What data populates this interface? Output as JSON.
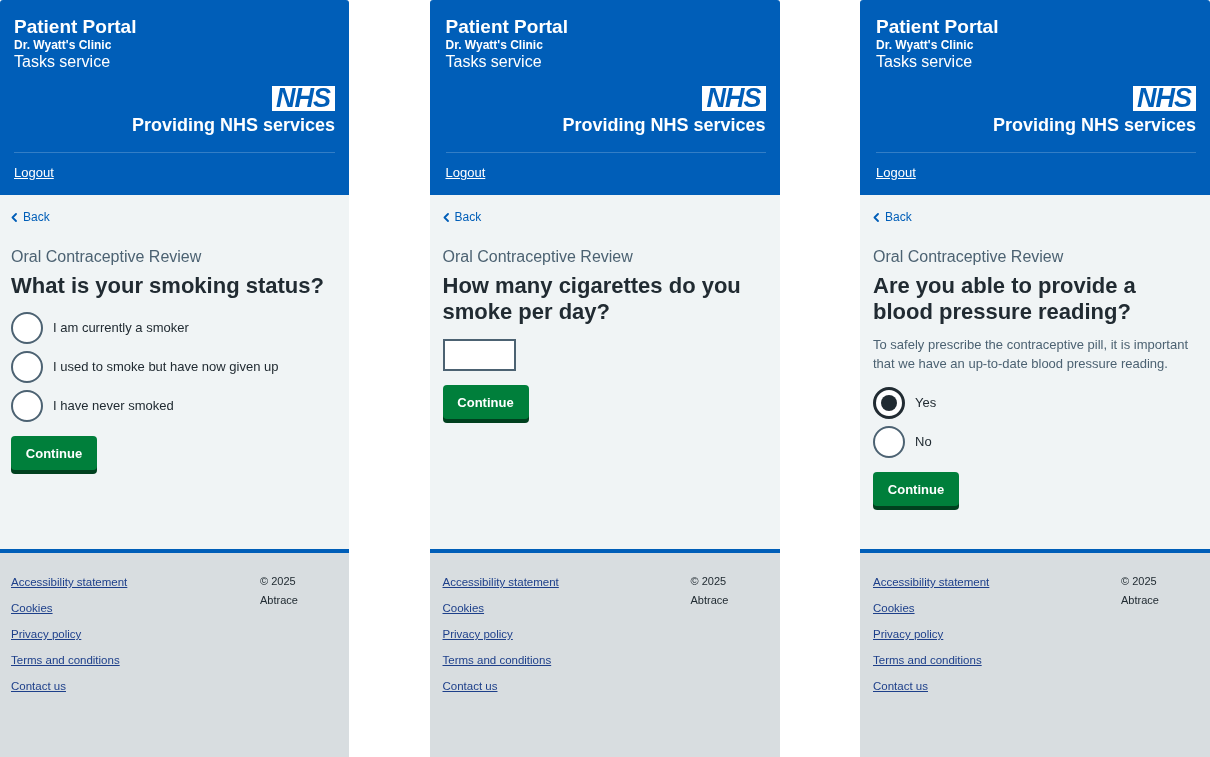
{
  "screens": [
    {
      "header": {
        "title": "Patient Portal",
        "clinic": "Dr. Wyatt's Clinic",
        "service": "Tasks service",
        "logo": "NHS",
        "tagline": "Providing NHS services",
        "logout": "Logout"
      },
      "back": "Back",
      "caption": "Oral Contraceptive Review",
      "question": "What is your smoking status?",
      "kind": "radios",
      "options": [
        {
          "label": "I am currently a smoker",
          "selected": false
        },
        {
          "label": "I used to smoke but have now given up",
          "selected": false
        },
        {
          "label": "I have never smoked",
          "selected": false
        }
      ],
      "button": "Continue",
      "footer": {
        "links": [
          "Accessibility statement",
          "Cookies",
          "Privacy policy",
          "Terms and conditions",
          "Contact us"
        ],
        "copyright": "© 2025",
        "company": "Abtrace"
      }
    },
    {
      "header": {
        "title": "Patient Portal",
        "clinic": "Dr. Wyatt's Clinic",
        "service": "Tasks service",
        "logo": "NHS",
        "tagline": "Providing NHS services",
        "logout": "Logout"
      },
      "back": "Back",
      "caption": "Oral Contraceptive Review",
      "question": "How many cigarettes do you smoke per day?",
      "kind": "text-input",
      "button": "Continue",
      "footer": {
        "links": [
          "Accessibility statement",
          "Cookies",
          "Privacy policy",
          "Terms and conditions",
          "Contact us"
        ],
        "copyright": "© 2025",
        "company": "Abtrace"
      }
    },
    {
      "header": {
        "title": "Patient Portal",
        "clinic": "Dr. Wyatt's Clinic",
        "service": "Tasks service",
        "logo": "NHS",
        "tagline": "Providing NHS services",
        "logout": "Logout"
      },
      "back": "Back",
      "caption": "Oral Contraceptive Review",
      "question": "Are you able to provide a blood pressure reading?",
      "hint": "To safely prescribe the contraceptive pill, it is important that we have an up-to-date blood pressure reading.",
      "kind": "radios",
      "options": [
        {
          "label": "Yes",
          "selected": true
        },
        {
          "label": "No",
          "selected": false
        }
      ],
      "button": "Continue",
      "footer": {
        "links": [
          "Accessibility statement",
          "Cookies",
          "Privacy policy",
          "Terms and conditions",
          "Contact us"
        ],
        "copyright": "© 2025",
        "company": "Abtrace"
      }
    }
  ]
}
